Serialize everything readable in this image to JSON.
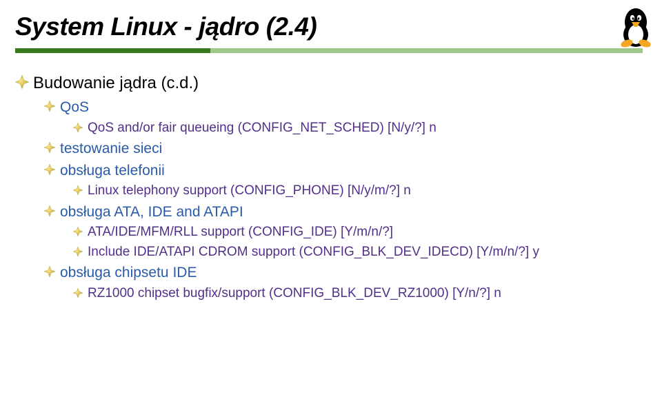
{
  "title": "System Linux  - jądro (2.4)",
  "items": [
    {
      "level": 1,
      "text": "Budowanie jądra (c.d.)"
    },
    {
      "level": 2,
      "text": "QoS"
    },
    {
      "level": 3,
      "text": "QoS and/or fair queueing (CONFIG_NET_SCHED) [N/y/?] n"
    },
    {
      "level": 2,
      "text": "testowanie sieci"
    },
    {
      "level": 2,
      "text": "obsługa telefonii"
    },
    {
      "level": 3,
      "text": "Linux telephony support (CONFIG_PHONE) [N/y/m/?] n"
    },
    {
      "level": 2,
      "text": "obsługa ATA, IDE and ATAPI"
    },
    {
      "level": 3,
      "text": "ATA/IDE/MFM/RLL support (CONFIG_IDE) [Y/m/n/?]"
    },
    {
      "level": 3,
      "text": "Include IDE/ATAPI CDROM support (CONFIG_BLK_DEV_IDECD) [Y/m/n/?] y"
    },
    {
      "level": 2,
      "text": "obsługa chipsetu IDE"
    },
    {
      "level": 3,
      "text": "RZ1000 chipset bugfix/support (CONFIG_BLK_DEV_RZ1000) [Y/n/?]  n"
    }
  ],
  "colors": {
    "barDark": "#3a7a1e",
    "barLight": "#9fc78a",
    "l2": "#2a5ba8",
    "l3": "#522f8a",
    "bulletOuter": "#b5a642",
    "bulletInner": "#ffe680"
  }
}
